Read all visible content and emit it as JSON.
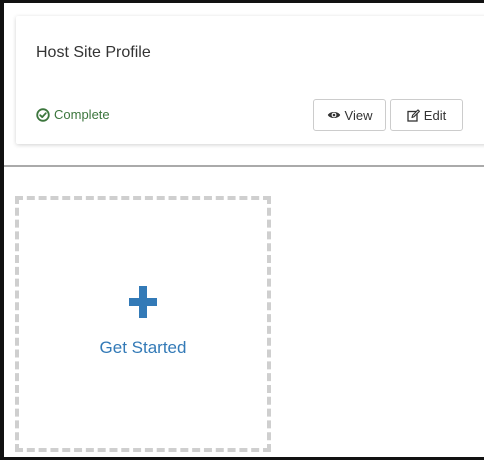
{
  "profile_card": {
    "title": "Host Site Profile",
    "status_label": "Complete",
    "status_icon": "check-circle-icon",
    "status_color": "#3c763d",
    "view_label": "View",
    "view_icon": "eye-icon",
    "edit_label": "Edit",
    "edit_icon": "edit-icon"
  },
  "get_started": {
    "label": "Get Started",
    "icon": "plus-icon",
    "accent_color": "#337ab7"
  }
}
